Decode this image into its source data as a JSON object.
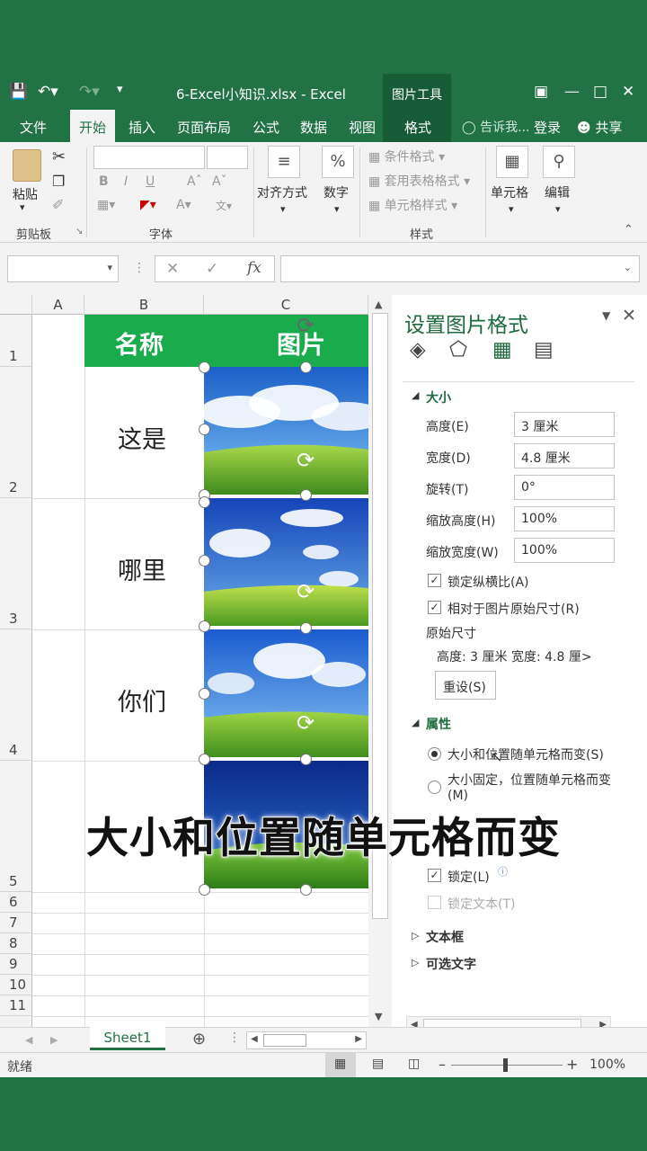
{
  "window": {
    "title": "6-Excel小知识.xlsx - Excel",
    "context_tab": "图片工具"
  },
  "tabs": [
    "文件",
    "开始",
    "插入",
    "页面布局",
    "公式",
    "数据",
    "视图",
    "格式"
  ],
  "tell_me": "告诉我...",
  "login": "登录",
  "share": "共享",
  "ribbon": {
    "paste": "粘贴",
    "clipboard": "剪贴板",
    "font": "字体",
    "align": "对齐方式",
    "number": "数字",
    "cond_format": "条件格式",
    "table_format": "套用表格格式",
    "cell_style": "单元格样式",
    "style": "样式",
    "cells": "单元格",
    "edit": "编辑",
    "bold": "B",
    "italic": "I",
    "underline": "U"
  },
  "sheet": {
    "columns": [
      "A",
      "B",
      "C"
    ],
    "rows": [
      "1",
      "2",
      "3",
      "4",
      "5",
      "6",
      "7",
      "8",
      "9",
      "10",
      "11"
    ],
    "header_b": "名称",
    "header_c": "图片",
    "cells": [
      "这是",
      "哪里",
      "你们"
    ],
    "tab": "Sheet1"
  },
  "pane": {
    "title": "设置图片格式",
    "size_section": "大小",
    "height_label": "高度(E)",
    "height_value": "3 厘米",
    "width_label": "宽度(D)",
    "width_value": "4.8 厘米",
    "rotate_label": "旋转(T)",
    "rotate_value": "0°",
    "scale_h_label": "缩放高度(H)",
    "scale_h_value": "100%",
    "scale_w_label": "缩放宽度(W)",
    "scale_w_value": "100%",
    "lock_ratio": "锁定纵横比(A)",
    "relative": "相对于图片原始尺寸(R)",
    "original": "原始尺寸",
    "orig_dims": "高度:  3 厘米   宽度:  4.8 厘>",
    "reset": "重设(S)",
    "props_section": "属性",
    "opt1": "大小和位置随单元格而变(S)",
    "opt2": "大小固定，位置随单元格而变",
    "opt2b": "(M)",
    "lock": "锁定(L)",
    "lock_text": "锁定文本(T)",
    "textbox": "文本框",
    "alt_text": "可选文字"
  },
  "status": {
    "ready": "就绪",
    "zoom": "100%"
  },
  "caption": "大小和位置随单元格而变",
  "colors": {
    "excel_green": "#217346",
    "header_fill": "#1aab4d"
  }
}
